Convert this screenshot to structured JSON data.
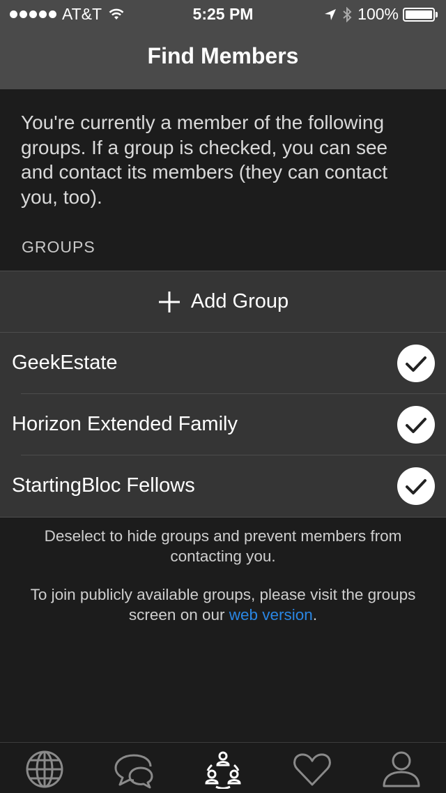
{
  "status_bar": {
    "carrier": "AT&T",
    "time": "5:25 PM",
    "battery": "100%"
  },
  "nav": {
    "title": "Find Members"
  },
  "intro_text": "You're currently a member of the following groups. If a group is checked, you can see and contact its members (they can contact you, too).",
  "groups_header": "GROUPS",
  "add_group_label": "Add Group",
  "groups": [
    {
      "name": "GeekEstate",
      "checked": true
    },
    {
      "name": "Horizon Extended Family",
      "checked": true
    },
    {
      "name": "StartingBloc Fellows",
      "checked": true
    }
  ],
  "deselect_note": "Deselect to hide groups and prevent members from contacting you.",
  "join_note": {
    "prefix": "To join publicly available groups, please visit the groups screen on our",
    "link": "web version",
    "suffix": "."
  },
  "tabs": [
    {
      "icon": "globe-icon",
      "active": false
    },
    {
      "icon": "chat-bubbles-icon",
      "active": false
    },
    {
      "icon": "group-members-icon",
      "active": true
    },
    {
      "icon": "heart-icon",
      "active": false
    },
    {
      "icon": "profile-icon",
      "active": false
    }
  ],
  "colors": {
    "nav": "#4a4a4a",
    "background": "#1c1c1c",
    "row": "#353535",
    "link": "#2a86e3"
  }
}
